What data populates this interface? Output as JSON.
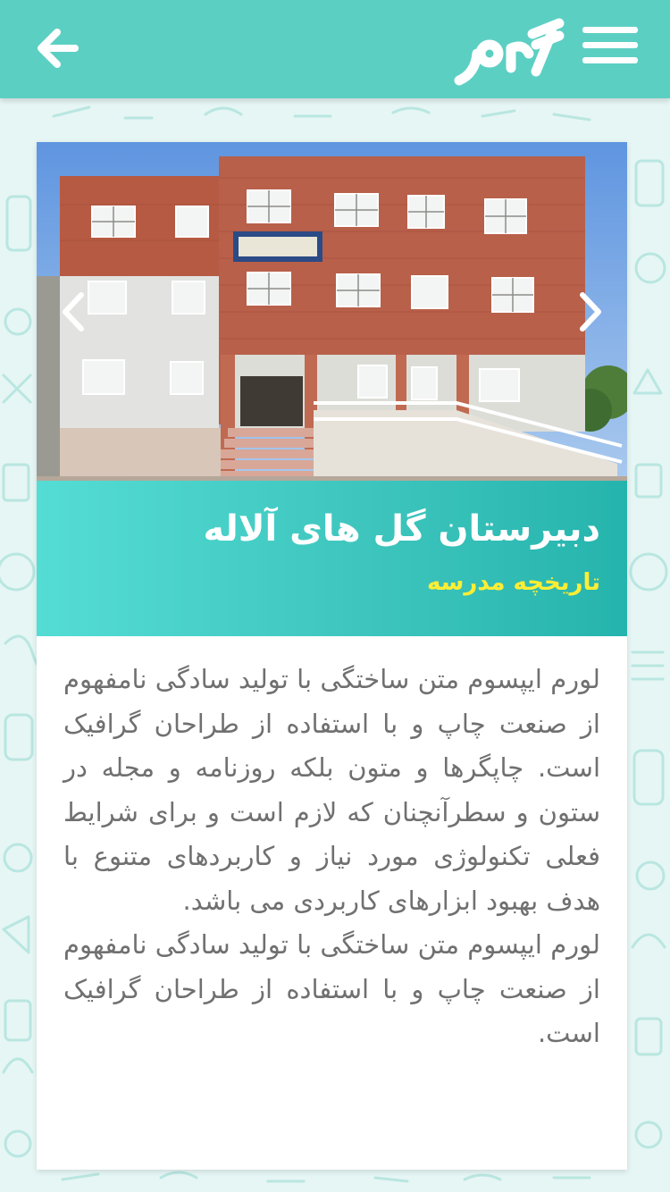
{
  "header": {
    "logo_text": "گلاور",
    "back_icon": "arrow-left-icon",
    "menu_icon": "hamburger-menu-icon",
    "color": "#5ccfc3"
  },
  "slider": {
    "prev_icon": "chevron-left-icon",
    "next_icon": "chevron-right-icon"
  },
  "school": {
    "name": "دبیرستان گل های آلاله",
    "section_title": "تاریخچه مدرسه"
  },
  "content": {
    "paragraphs": [
      "لورم ایپسوم متن ساختگی با تولید سادگی نامفهوم از صنعت چاپ و با استفاده از طراحان گرافیک است. چاپگرها و متون بلکه روزنامه و مجله در ستون و سطرآنچنان که لازم است و برای شرایط فعلی تکنولوژی مورد نیاز و کاربردهای متنوع با هدف بهبود ابزارهای کاربردی می باشد.",
      "لورم ایپسوم متن ساختگی با تولید سادگی نامفهوم از صنعت چاپ و با استفاده از طراحان گرافیک است."
    ]
  },
  "colors": {
    "accent": "#5ccfc3",
    "subtitle": "#ffee33",
    "text": "#707070"
  }
}
